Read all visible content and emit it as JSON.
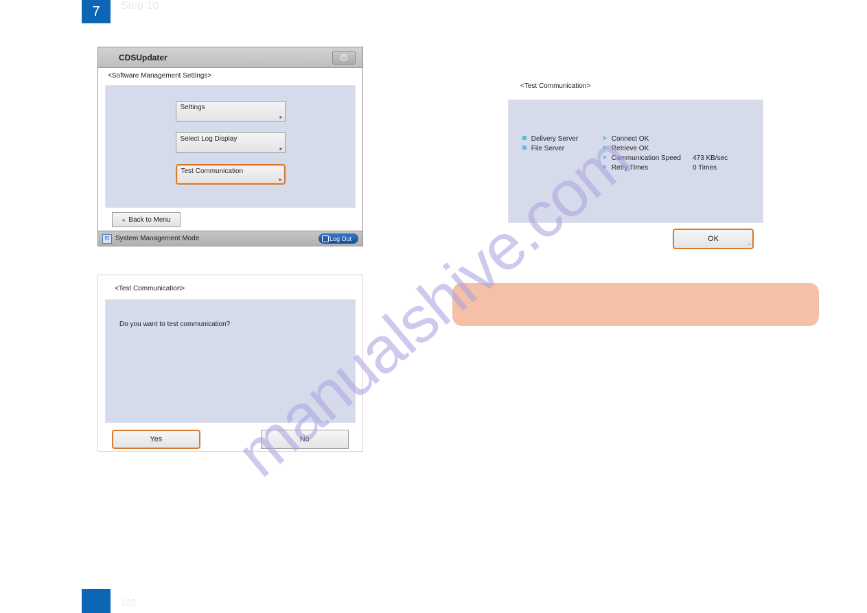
{
  "page": {
    "top_badge": "7",
    "step_label": "Step 10",
    "page_number": "122"
  },
  "watermark": "manualshive.com",
  "shotA": {
    "title": "CDSUpdater",
    "section": "<Software Management Settings>",
    "menu": {
      "settings": "Settings",
      "select_log": "Select Log Display",
      "test_comm": "Test Communication"
    },
    "back": "Back to Menu",
    "status_mode": "System Management Mode",
    "logout": "Log Out"
  },
  "shotB": {
    "section": "<Test Communication>",
    "question": "Do you want to test communication?",
    "yes": "Yes",
    "no": "No"
  },
  "shotC": {
    "section": "<Test Communication>",
    "left": {
      "delivery": "Delivery Server",
      "file": "File Server"
    },
    "mid": {
      "connect": "Connect OK",
      "retrieve": "Retrieve OK",
      "speed_label": "Communication Speed",
      "retry_label": "Retry Times"
    },
    "vals": {
      "speed": "473 KB/sec",
      "retry": "0 Times"
    },
    "ok": "OK"
  }
}
